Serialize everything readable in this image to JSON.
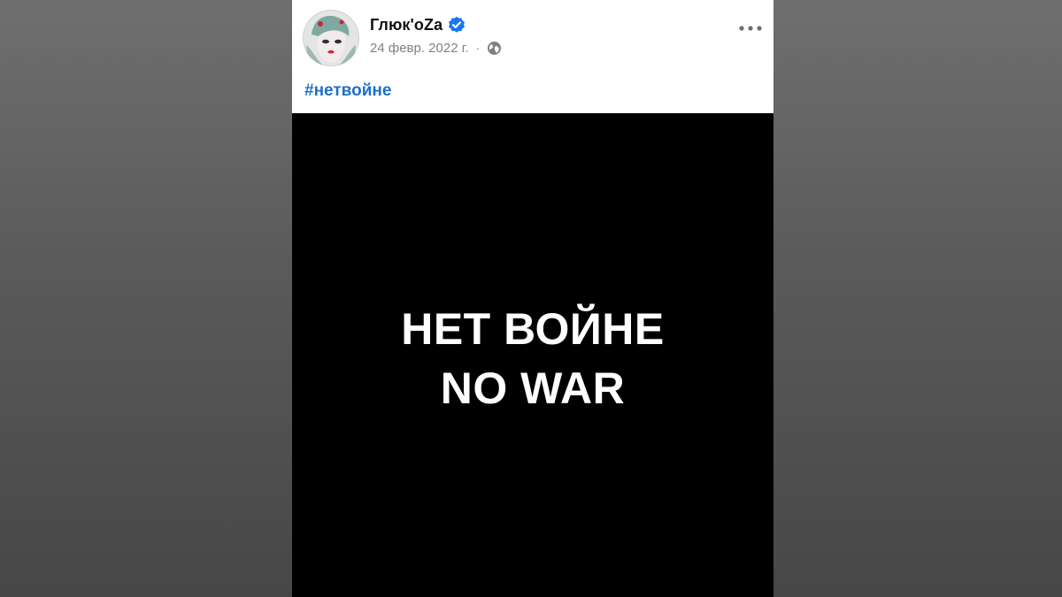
{
  "post": {
    "author": "Глюк'oZa",
    "date": "24 февр. 2022 г.",
    "separator": "·",
    "hashtag": "#нетвойне",
    "image_lines": [
      "НЕТ ВОЙНЕ",
      "NO WAR"
    ]
  },
  "icons": {
    "verified": "verified-badge-icon",
    "audience": "globe-icon",
    "menu": "more-options-icon"
  },
  "colors": {
    "hashtag": "#1f6fc6",
    "verified": "#1877f2",
    "meta": "#7d8186",
    "media_background": "#000000"
  }
}
